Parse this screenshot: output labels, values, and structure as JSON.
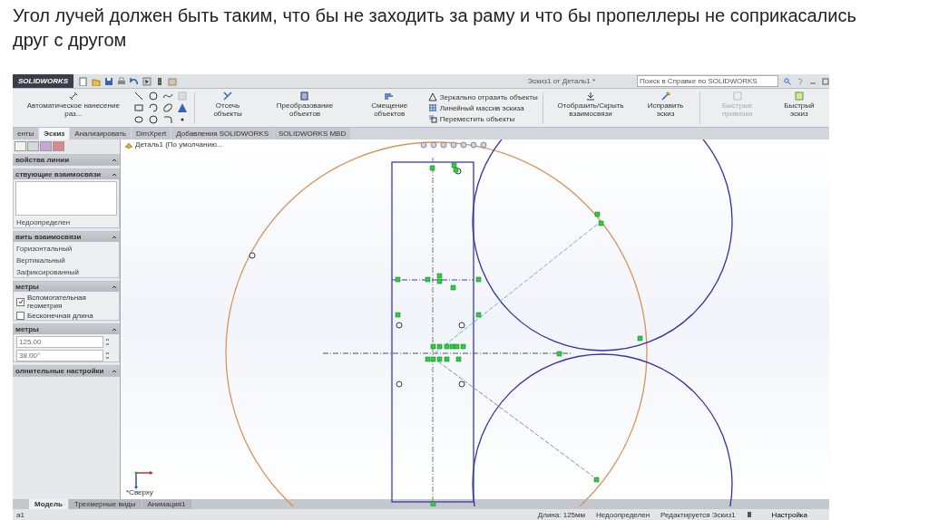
{
  "slide_title": "Угол лучей должен быть таким, что бы не заходить за раму и что бы пропеллеры не соприкасались друг с другом",
  "window": {
    "logo": "SOLIDWORKS",
    "title": "Эскиз1 от Деталь1 *",
    "search": {
      "placeholder": "Поиск в Справке по SOLIDWORKS"
    }
  },
  "ribbon": [
    {
      "label": "Автоматическое нанесение раз...",
      "disabled": false
    },
    {
      "label": "Отсечь объекты",
      "disabled": false
    },
    {
      "label": "Преобразование объектов",
      "disabled": false
    },
    {
      "label": "Смещение объектов",
      "disabled": false
    },
    {
      "label": "Зеркально отразить объекты",
      "disabled": false
    },
    {
      "label": "Линейный массив эскиза",
      "disabled": false
    },
    {
      "label": "Переместить объекты",
      "disabled": false
    },
    {
      "label": "Отобразить/Скрыть взаимосвязи",
      "disabled": false
    },
    {
      "label": "Исправить эскиз",
      "disabled": false
    },
    {
      "label": "Быстрые привязки",
      "disabled": true
    },
    {
      "label": "Быстрый эскиз",
      "disabled": false
    }
  ],
  "tabs": [
    {
      "label": "енты",
      "selected": false
    },
    {
      "label": "Эскиз",
      "selected": true
    },
    {
      "label": "Анализировать",
      "selected": false
    },
    {
      "label": "DimXpert",
      "selected": false
    },
    {
      "label": "Добавления SOLIDWORKS",
      "selected": false
    },
    {
      "label": "SOLIDWORKS MBD",
      "selected": false
    }
  ],
  "panel": {
    "sections": [
      {
        "title": "войства линии"
      },
      {
        "title": "ствующие взаимосвязи",
        "status": "Недоопределен"
      },
      {
        "title": "вить взаимосвязи",
        "items": [
          "Горизонтальный",
          "Вертикальный",
          "Зафиксированный"
        ]
      },
      {
        "title": "метры",
        "options": [
          {
            "label": "Вспомогательная геометрия",
            "checked": true
          },
          {
            "label": "Бесконечная длина",
            "checked": false
          }
        ]
      },
      {
        "title": "метры",
        "fields": [
          "125.00",
          "38.00°"
        ]
      },
      {
        "title": "олнительные настройки"
      }
    ]
  },
  "tree": {
    "item": "Деталь1  (По умолчанию..."
  },
  "view_label": "*Сверху",
  "bottom_tabs": [
    {
      "label": "Модель",
      "selected": true
    },
    {
      "label": "Трехмерные виды",
      "selected": false
    },
    {
      "label": "Анимация1",
      "selected": false
    }
  ],
  "status_bar": {
    "left": "а1",
    "items": [
      "Длина: 125мм",
      "Недоопределен",
      "Редактируется Эскиз1"
    ],
    "customize": "Настройка"
  }
}
